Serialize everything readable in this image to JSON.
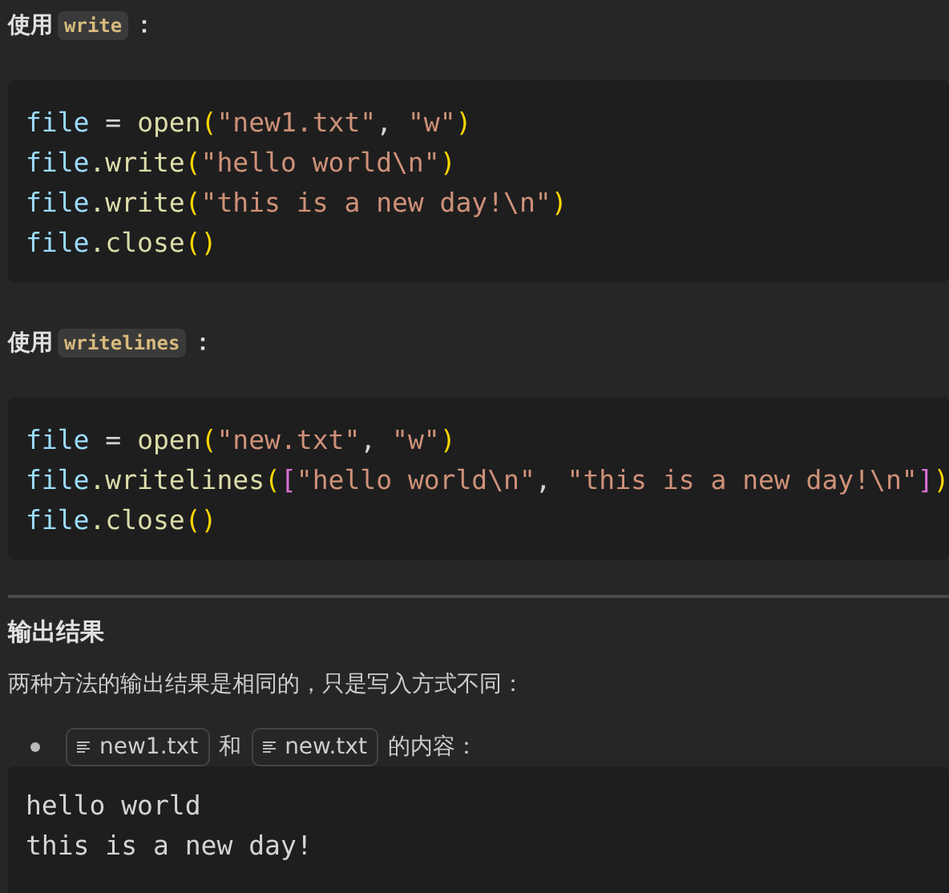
{
  "examples": [
    {
      "heading": {
        "prefix": "使用",
        "code": "write",
        "suffix": "："
      },
      "code_lines": [
        [
          {
            "kind": "var",
            "text": "file"
          },
          {
            "kind": "op",
            "text": " = "
          },
          {
            "kind": "func",
            "text": "open"
          },
          {
            "kind": "paren",
            "text": "("
          },
          {
            "kind": "string",
            "text": "\"new1.txt\""
          },
          {
            "kind": "op",
            "text": ", "
          },
          {
            "kind": "string",
            "text": "\"w\""
          },
          {
            "kind": "paren",
            "text": ")"
          }
        ],
        [
          {
            "kind": "var",
            "text": "file"
          },
          {
            "kind": "func",
            "text": ".write"
          },
          {
            "kind": "paren",
            "text": "("
          },
          {
            "kind": "string",
            "text": "\"hello world\\n\""
          },
          {
            "kind": "paren",
            "text": ")"
          }
        ],
        [
          {
            "kind": "var",
            "text": "file"
          },
          {
            "kind": "func",
            "text": ".write"
          },
          {
            "kind": "paren",
            "text": "("
          },
          {
            "kind": "string",
            "text": "\"this is a new day!\\n\""
          },
          {
            "kind": "paren",
            "text": ")"
          }
        ],
        [
          {
            "kind": "var",
            "text": "file"
          },
          {
            "kind": "func",
            "text": ".close"
          },
          {
            "kind": "paren",
            "text": "()"
          }
        ]
      ]
    },
    {
      "heading": {
        "prefix": "使用",
        "code": "writelines",
        "suffix": "："
      },
      "code_lines": [
        [
          {
            "kind": "var",
            "text": "file"
          },
          {
            "kind": "op",
            "text": " = "
          },
          {
            "kind": "func",
            "text": "open"
          },
          {
            "kind": "paren",
            "text": "("
          },
          {
            "kind": "string",
            "text": "\"new.txt\""
          },
          {
            "kind": "op",
            "text": ", "
          },
          {
            "kind": "string",
            "text": "\"w\""
          },
          {
            "kind": "paren",
            "text": ")"
          }
        ],
        [
          {
            "kind": "var",
            "text": "file"
          },
          {
            "kind": "func",
            "text": ".writelines"
          },
          {
            "kind": "paren",
            "text": "("
          },
          {
            "kind": "bracket",
            "text": "["
          },
          {
            "kind": "string",
            "text": "\"hello world\\n\""
          },
          {
            "kind": "op",
            "text": ", "
          },
          {
            "kind": "string",
            "text": "\"this is a new day!\\n\""
          },
          {
            "kind": "bracket",
            "text": "]"
          },
          {
            "kind": "paren",
            "text": ")"
          }
        ],
        [
          {
            "kind": "var",
            "text": "file"
          },
          {
            "kind": "func",
            "text": ".close"
          },
          {
            "kind": "paren",
            "text": "()"
          }
        ]
      ]
    }
  ],
  "result": {
    "title": "输出结果",
    "paragraph": "两种方法的输出结果是相同的，只是写入方式不同：",
    "list_item": [
      {
        "kind": "file",
        "text": "new1.txt"
      },
      {
        "kind": "text",
        "text": "和"
      },
      {
        "kind": "file",
        "text": "new.txt"
      },
      {
        "kind": "text",
        "text": "的内容："
      }
    ],
    "output_lines": [
      "hello world",
      "this is a new day!"
    ]
  }
}
